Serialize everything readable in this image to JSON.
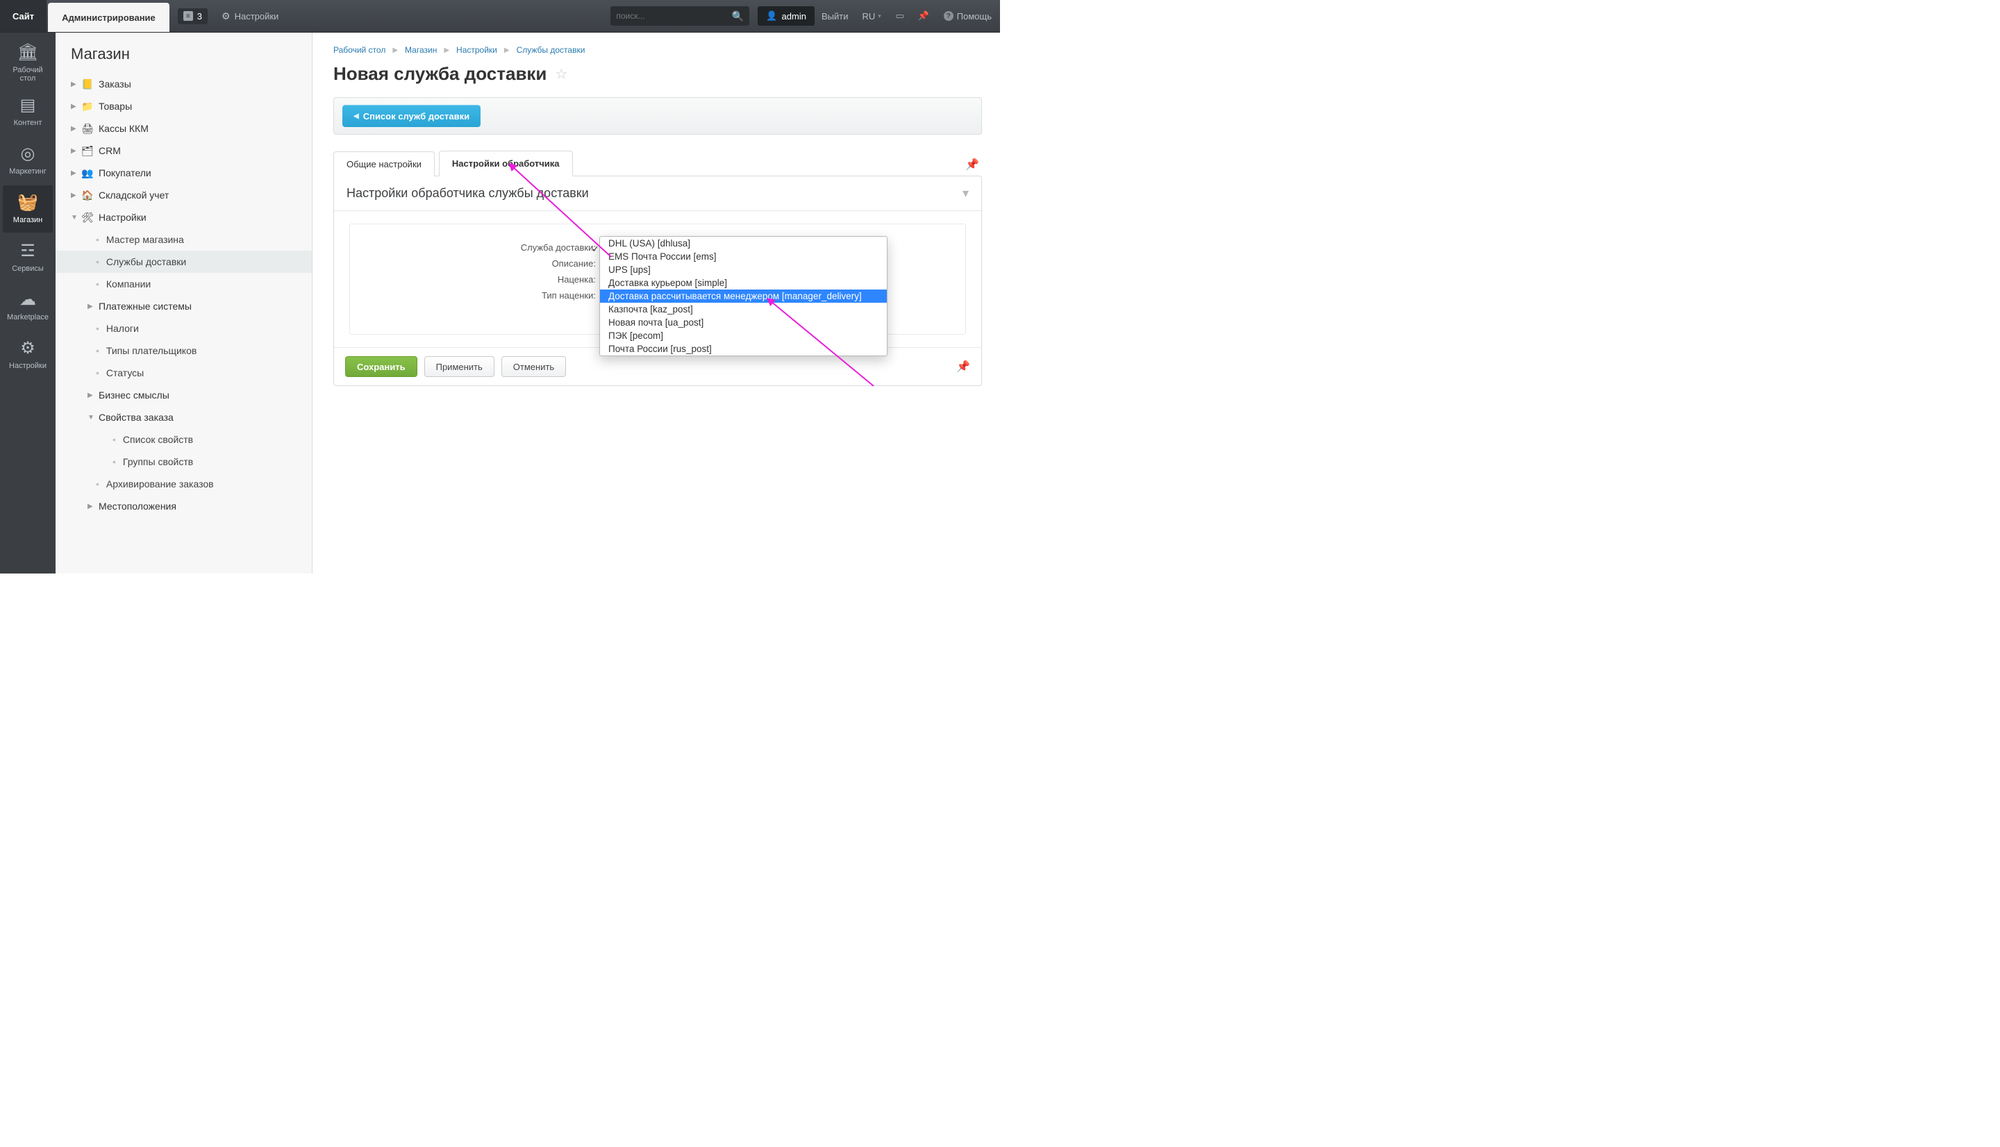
{
  "topbar": {
    "site_tab": "Сайт",
    "admin_tab": "Администрирование",
    "notif_count": "3",
    "settings_label": "Настройки",
    "search_placeholder": "поиск...",
    "user_label": "admin",
    "logout_label": "Выйти",
    "lang_label": "RU",
    "help_label": "Помощь"
  },
  "rail": [
    {
      "id": "desktop",
      "label": "Рабочий\nстол"
    },
    {
      "id": "content",
      "label": "Контент"
    },
    {
      "id": "marketing",
      "label": "Маркетинг"
    },
    {
      "id": "store",
      "label": "Магазин"
    },
    {
      "id": "services",
      "label": "Сервисы"
    },
    {
      "id": "marketplace",
      "label": "Marketplace"
    },
    {
      "id": "settings",
      "label": "Настройки"
    }
  ],
  "sidebar": {
    "title": "Магазин",
    "items": {
      "orders": "Заказы",
      "goods": "Товары",
      "kkm": "Кассы ККМ",
      "crm": "CRM",
      "buyers": "Покупатели",
      "warehouse": "Складской учет",
      "settings": "Настройки",
      "wizard": "Мастер магазина",
      "delivery": "Службы доставки",
      "companies": "Компании",
      "paysys": "Платежные системы",
      "taxes": "Налоги",
      "payertypes": "Типы плательщиков",
      "statuses": "Статусы",
      "bizsense": "Бизнес смыслы",
      "orderprops": "Свойства заказа",
      "proplist": "Список свойств",
      "propgroups": "Группы свойств",
      "archiving": "Архивирование заказов",
      "locations": "Местоположения"
    }
  },
  "breadcrumbs": [
    "Рабочий стол",
    "Магазин",
    "Настройки",
    "Службы доставки"
  ],
  "page": {
    "title": "Новая служба доставки",
    "list_button": "Список служб доставки"
  },
  "tabs": {
    "general": "Общие настройки",
    "handler": "Настройки обработчика"
  },
  "panel": {
    "heading": "Настройки обработчика службы доставки",
    "labels": {
      "service": "Служба доставки:",
      "description": "Описание:",
      "markup": "Наценка:",
      "markup_type": "Тип наценки:"
    }
  },
  "buttons": {
    "save": "Сохранить",
    "apply": "Применить",
    "cancel": "Отменить"
  },
  "dropdown": {
    "options": [
      "DHL (USA) [dhlusa]",
      "EMS Почта России [ems]",
      "UPS [ups]",
      "Доставка курьером [simple]",
      "Доставка рассчитывается менеджером [manager_delivery]",
      "Казпочта [kaz_post]",
      "Новая почта [ua_post]",
      "ПЭК [pecom]",
      "Почта России [rus_post]"
    ],
    "selected_index": 4
  },
  "colors": {
    "accent_blue": "#2aa4d5",
    "selection_blue": "#2e86ff",
    "save_green": "#72aa3a",
    "annotation_pink": "#e81fd9"
  }
}
